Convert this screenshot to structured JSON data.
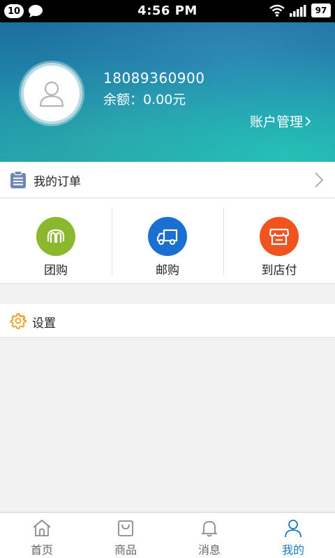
{
  "status_bar": {
    "notification_count": "10",
    "time": "4:56 PM",
    "battery": "97",
    "icons": [
      "chat-bubble-icon",
      "wifi-icon",
      "signal-icon",
      "battery-icon"
    ]
  },
  "profile": {
    "phone": "18089360900",
    "balance": "余额：0.00元",
    "account_link": "账户管理",
    "avatar_icon": "user-avatar-icon"
  },
  "orders": {
    "label": "我的订单",
    "icon": "clipboard-icon"
  },
  "categories": [
    {
      "label": "团购",
      "icon": "group-buy-icon",
      "color": "#8bb82e"
    },
    {
      "label": "邮购",
      "icon": "truck-icon",
      "color": "#1a6fd0"
    },
    {
      "label": "到店付",
      "icon": "store-icon",
      "color": "#f0531e"
    }
  ],
  "settings": {
    "label": "设置",
    "icon": "gear-icon",
    "icon_color": "#f0a020"
  },
  "bottom_nav": {
    "active_color": "#1a78c2",
    "items": [
      {
        "label": "首页",
        "icon": "home-icon",
        "active": false
      },
      {
        "label": "商品",
        "icon": "shopping-bag-icon",
        "active": false
      },
      {
        "label": "消息",
        "icon": "bell-icon",
        "active": false
      },
      {
        "label": "我的",
        "icon": "person-icon",
        "active": true
      }
    ]
  }
}
